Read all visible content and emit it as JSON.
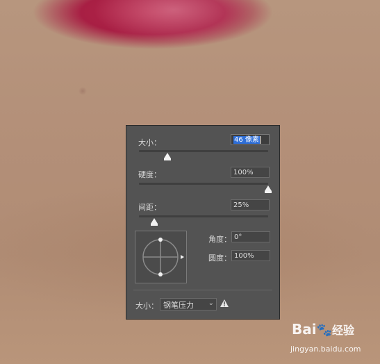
{
  "brush_panel": {
    "size_label": "大小：",
    "size_value": "46 像素",
    "size_slider_fraction": 0.2,
    "hardness_label": "硬度：",
    "hardness_value": "100%",
    "hardness_slider_fraction": 1.0,
    "spacing_label": "间距：",
    "spacing_value": "25%",
    "spacing_slider_fraction": 0.12,
    "angle_label": "角度：",
    "angle_value": "0°",
    "roundness_label": "圆度：",
    "roundness_value": "100%",
    "size_control_label": "大小：",
    "size_control_selected": "钢笔压力"
  },
  "watermark": {
    "logo_text": "Bai",
    "logo_cn": "经验",
    "url": "jingyan.baidu.com"
  },
  "colors": {
    "panel_bg": "#535353",
    "highlight": "#2f6fd8"
  }
}
